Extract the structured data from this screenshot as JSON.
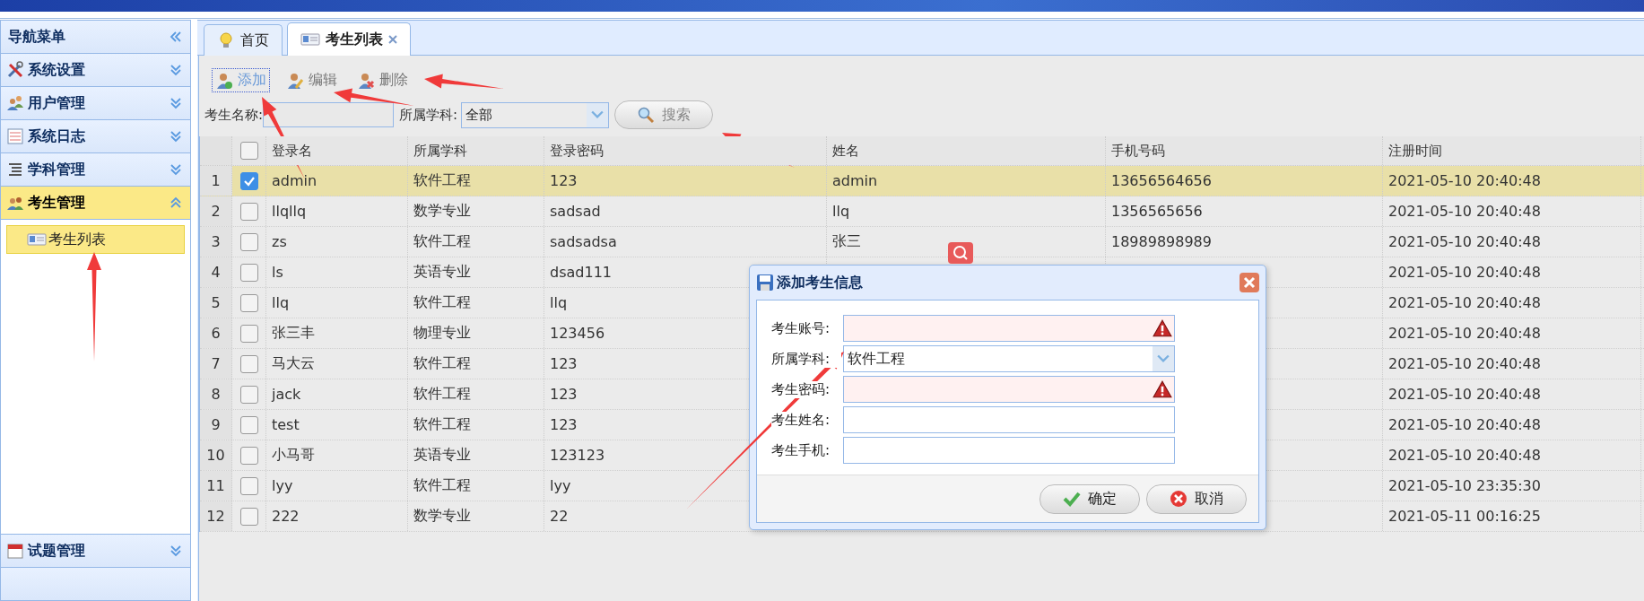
{
  "sidebar": {
    "title": "导航菜单",
    "panels": [
      {
        "label": "系统设置",
        "expanded": false,
        "selected": false
      },
      {
        "label": "用户管理",
        "expanded": false,
        "selected": false
      },
      {
        "label": "系统日志",
        "expanded": false,
        "selected": false
      },
      {
        "label": "学科管理",
        "expanded": false,
        "selected": false
      },
      {
        "label": "考生管理",
        "expanded": true,
        "selected": true,
        "children": [
          {
            "label": "考生列表",
            "selected": true
          }
        ]
      },
      {
        "label": "试题管理",
        "expanded": false,
        "selected": false
      }
    ]
  },
  "tabs": [
    {
      "label": "首页",
      "selected": false,
      "closable": false
    },
    {
      "label": "考生列表",
      "selected": true,
      "closable": true
    }
  ],
  "toolbar": [
    {
      "label": "添加",
      "focused": true
    },
    {
      "label": "编辑",
      "focused": false
    },
    {
      "label": "删除",
      "focused": false
    }
  ],
  "search": {
    "name_label": "考生名称:",
    "subject_label": "所属学科:",
    "subject_value": "全部",
    "button": "搜索"
  },
  "table": {
    "select_all_checked": false,
    "columns": [
      "登录名",
      "所属学科",
      "登录密码",
      "姓名",
      "手机号码",
      "注册时间"
    ],
    "rows": [
      {
        "index": "1",
        "checked": true,
        "selected": true,
        "cells": [
          "admin",
          "软件工程",
          "123",
          "admin",
          "13656564656",
          "2021-05-10 20:40:48"
        ]
      },
      {
        "index": "2",
        "checked": false,
        "selected": false,
        "cells": [
          "llqllq",
          "数学专业",
          "sadsad",
          "llq",
          "1356565656",
          "2021-05-10 20:40:48"
        ]
      },
      {
        "index": "3",
        "checked": false,
        "selected": false,
        "cells": [
          "zs",
          "软件工程",
          "sadsadsa",
          "张三",
          "18989898989",
          "2021-05-10 20:40:48"
        ]
      },
      {
        "index": "4",
        "checked": false,
        "selected": false,
        "cells": [
          "ls",
          "英语专业",
          "dsad111",
          null,
          null,
          "2021-05-10 20:40:48"
        ]
      },
      {
        "index": "5",
        "checked": false,
        "selected": false,
        "cells": [
          "llq",
          "软件工程",
          "llq",
          null,
          null,
          "2021-05-10 20:40:48"
        ]
      },
      {
        "index": "6",
        "checked": false,
        "selected": false,
        "cells": [
          "张三丰",
          "物理专业",
          "123456",
          null,
          null,
          "2021-05-10 20:40:48"
        ]
      },
      {
        "index": "7",
        "checked": false,
        "selected": false,
        "cells": [
          "马大云",
          "软件工程",
          "123",
          null,
          null,
          "2021-05-10 20:40:48"
        ]
      },
      {
        "index": "8",
        "checked": false,
        "selected": false,
        "cells": [
          "jack",
          "软件工程",
          "123",
          null,
          null,
          "2021-05-10 20:40:48"
        ]
      },
      {
        "index": "9",
        "checked": false,
        "selected": false,
        "cells": [
          "test",
          "软件工程",
          "123",
          null,
          null,
          "2021-05-10 20:40:48"
        ]
      },
      {
        "index": "10",
        "checked": false,
        "selected": false,
        "cells": [
          "小马哥",
          "英语专业",
          "123123",
          null,
          null,
          "2021-05-10 20:40:48"
        ]
      },
      {
        "index": "11",
        "checked": false,
        "selected": false,
        "cells": [
          "lyy",
          "软件工程",
          "lyy",
          null,
          null,
          "2021-05-10 23:35:30"
        ]
      },
      {
        "index": "12",
        "checked": false,
        "selected": false,
        "cells": [
          "222",
          "数学专业",
          "22",
          null,
          null,
          "2021-05-11 00:16:25"
        ]
      }
    ]
  },
  "dialog": {
    "title": "添加考生信息",
    "fields": [
      {
        "label": "考生账号:",
        "kind": "text",
        "invalid": true
      },
      {
        "label": "所属学科:",
        "kind": "select",
        "value": "软件工程"
      },
      {
        "label": "考生密码:",
        "kind": "text",
        "invalid": true
      },
      {
        "label": "考生姓名:",
        "kind": "text",
        "invalid": false
      },
      {
        "label": "考生手机:",
        "kind": "text",
        "invalid": false
      }
    ],
    "buttons": [
      {
        "label": "确定",
        "kind": "ok"
      },
      {
        "label": "取消",
        "kind": "cancel"
      }
    ]
  }
}
